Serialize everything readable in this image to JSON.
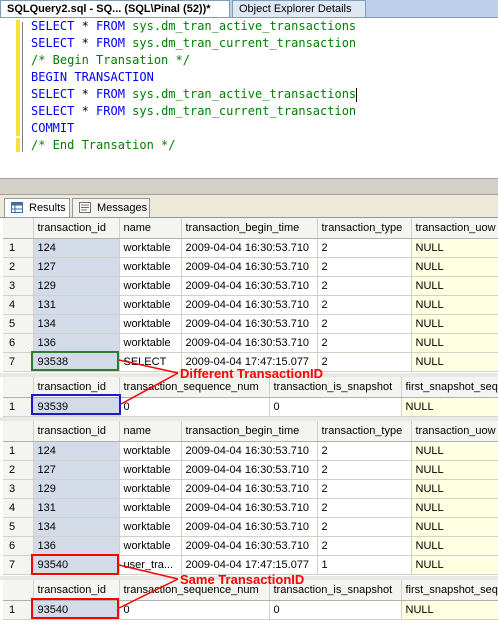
{
  "tabs": {
    "active": "SQLQuery2.sql - SQ... (SQL\\Pinal (52))*",
    "inactive": "Object Explorer Details"
  },
  "editor": {
    "lines": [
      {
        "kw": "SELECT",
        "star": " * ",
        "from": "FROM",
        "obj": " sys.dm_tran_active_transactions"
      },
      {
        "kw": "SELECT",
        "star": " * ",
        "from": "FROM",
        "obj": " sys.dm_tran_current_transaction"
      },
      {
        "comment": "/* Begin Transation */"
      },
      {
        "plain": "BEGIN TRANSACTION"
      },
      {
        "kw": "SELECT",
        "star": " * ",
        "from": "FROM",
        "obj": " sys.dm_tran_active_transactions"
      },
      {
        "kw": "SELECT",
        "star": " * ",
        "from": "FROM",
        "obj": " sys.dm_tran_current_transaction"
      },
      {
        "plain": "COMMIT"
      },
      {
        "comment": "/* End Transation */"
      }
    ]
  },
  "result_tabs": {
    "results": "Results",
    "messages": "Messages"
  },
  "grid_active": {
    "columns": [
      "transaction_id",
      "name",
      "transaction_begin_time",
      "transaction_type",
      "transaction_uow"
    ],
    "rows1": [
      [
        "1",
        "124",
        "worktable",
        "2009-04-04 16:30:53.710",
        "2",
        "NULL"
      ],
      [
        "2",
        "127",
        "worktable",
        "2009-04-04 16:30:53.710",
        "2",
        "NULL"
      ],
      [
        "3",
        "129",
        "worktable",
        "2009-04-04 16:30:53.710",
        "2",
        "NULL"
      ],
      [
        "4",
        "131",
        "worktable",
        "2009-04-04 16:30:53.710",
        "2",
        "NULL"
      ],
      [
        "5",
        "134",
        "worktable",
        "2009-04-04 16:30:53.710",
        "2",
        "NULL"
      ],
      [
        "6",
        "136",
        "worktable",
        "2009-04-04 16:30:53.710",
        "2",
        "NULL"
      ],
      [
        "7",
        "93538",
        "SELECT",
        "2009-04-04 17:47:15.077",
        "2",
        "NULL"
      ]
    ],
    "rows2": [
      [
        "1",
        "124",
        "worktable",
        "2009-04-04 16:30:53.710",
        "2",
        "NULL"
      ],
      [
        "2",
        "127",
        "worktable",
        "2009-04-04 16:30:53.710",
        "2",
        "NULL"
      ],
      [
        "3",
        "129",
        "worktable",
        "2009-04-04 16:30:53.710",
        "2",
        "NULL"
      ],
      [
        "4",
        "131",
        "worktable",
        "2009-04-04 16:30:53.710",
        "2",
        "NULL"
      ],
      [
        "5",
        "134",
        "worktable",
        "2009-04-04 16:30:53.710",
        "2",
        "NULL"
      ],
      [
        "6",
        "136",
        "worktable",
        "2009-04-04 16:30:53.710",
        "2",
        "NULL"
      ],
      [
        "7",
        "93540",
        "user_tra...",
        "2009-04-04 17:47:15.077",
        "1",
        "NULL"
      ]
    ]
  },
  "grid_current": {
    "columns": [
      "transaction_id",
      "transaction_sequence_num",
      "transaction_is_snapshot",
      "first_snapshot_sequ"
    ],
    "row1": [
      "1",
      "93539",
      "0",
      "0",
      "NULL"
    ],
    "row2": [
      "1",
      "93540",
      "0",
      "0",
      "NULL"
    ]
  },
  "annotations": {
    "different": "Different TransactionID",
    "same": "Same TransactionID"
  },
  "colors": {
    "annotation": "#ff0000",
    "box_green": "#2e7d32",
    "box_blue": "#1a1ad0",
    "box_red": "#ff0000",
    "null_cell": "#ffffe1"
  }
}
